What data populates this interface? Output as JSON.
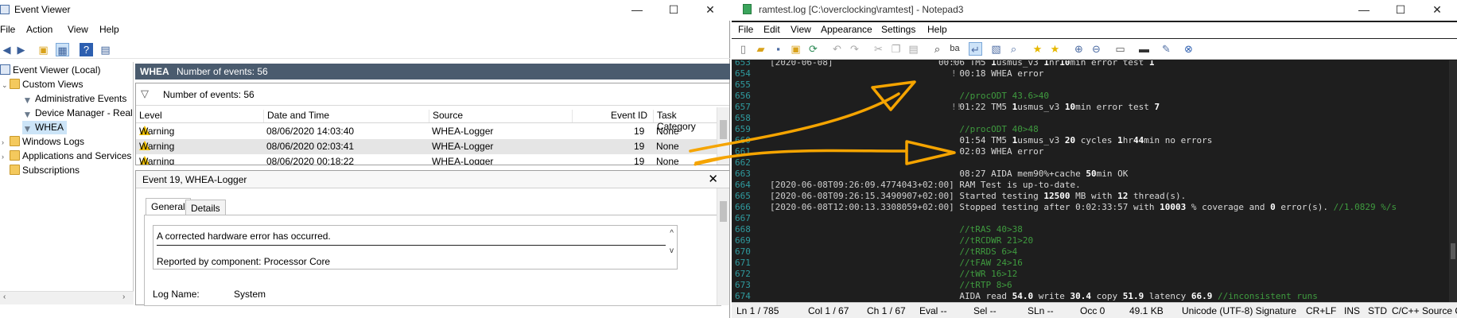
{
  "event_viewer": {
    "title": "Event Viewer",
    "menu": [
      "File",
      "Action",
      "View",
      "Help"
    ],
    "tree": {
      "root": "Event Viewer (Local)",
      "custom_views": "Custom Views",
      "admin_events": "Administrative Events",
      "device_manager": "Device Manager - Real",
      "whea": "WHEA",
      "windows_logs": "Windows Logs",
      "apps_services": "Applications and Services",
      "subscriptions": "Subscriptions"
    },
    "header": {
      "title": "WHEA",
      "count": "Number of events: 56"
    },
    "filter_text": "Number of events: 56",
    "columns": [
      "Level",
      "Date and Time",
      "Source",
      "Event ID",
      "Task Category"
    ],
    "rows": [
      {
        "level": "Warning",
        "datetime": "08/06/2020 14:03:40",
        "source": "WHEA-Logger",
        "event_id": "19",
        "task": "None"
      },
      {
        "level": "Warning",
        "datetime": "08/06/2020 02:03:41",
        "source": "WHEA-Logger",
        "event_id": "19",
        "task": "None"
      },
      {
        "level": "Warning",
        "datetime": "08/06/2020 00:18:22",
        "source": "WHEA-Logger",
        "event_id": "19",
        "task": "None"
      }
    ],
    "detail": {
      "title": "Event 19, WHEA-Logger",
      "tabs": [
        "General",
        "Details"
      ],
      "line1": "A corrected hardware error has occurred.",
      "line2": "Reported by component: Processor Core",
      "log_name_label": "Log Name:",
      "log_name_value": "System"
    }
  },
  "notepad": {
    "title": "ramtest.log [C:\\overclocking\\ramtest] - Notepad3",
    "menu": [
      "File",
      "Edit",
      "View",
      "Appearance",
      "Settings",
      "Help"
    ],
    "lines": [
      {
        "n": "653",
        "mark": "!",
        "parts": [
          [
            "br",
            "[2020-06-08]"
          ],
          [
            "def",
            "                    "
          ],
          [
            "def",
            "00:06 TM5 "
          ],
          [
            "num",
            "1"
          ],
          [
            "def",
            "usmus_v3 "
          ],
          [
            "num",
            "1"
          ],
          [
            "def",
            "hr"
          ],
          [
            "num",
            "10"
          ],
          [
            "def",
            "min error test "
          ],
          [
            "num",
            "1"
          ]
        ]
      },
      {
        "n": "654",
        "mark": "!",
        "parts": [
          [
            "def",
            "                                    00:18 WHEA error"
          ]
        ]
      },
      {
        "n": "655",
        "mark": "",
        "parts": []
      },
      {
        "n": "656",
        "mark": "",
        "parts": [
          [
            "def",
            "                                    "
          ],
          [
            "cm",
            "//procODT 43.6>40"
          ]
        ]
      },
      {
        "n": "657",
        "mark": "!!",
        "parts": [
          [
            "def",
            "                                    01:22 TM5 "
          ],
          [
            "num",
            "1"
          ],
          [
            "def",
            "usmus_v3 "
          ],
          [
            "num",
            "10"
          ],
          [
            "def",
            "min error test "
          ],
          [
            "num",
            "7"
          ]
        ]
      },
      {
        "n": "658",
        "mark": "",
        "parts": []
      },
      {
        "n": "659",
        "mark": "",
        "parts": [
          [
            "def",
            "                                    "
          ],
          [
            "cm",
            "//procODT 40>48"
          ]
        ]
      },
      {
        "n": "660",
        "mark": "",
        "parts": [
          [
            "def",
            "                                    01:54 TM5 "
          ],
          [
            "num",
            "1"
          ],
          [
            "def",
            "usmus_v3 "
          ],
          [
            "num",
            "20"
          ],
          [
            "def",
            " cycles "
          ],
          [
            "num",
            "1"
          ],
          [
            "def",
            "hr"
          ],
          [
            "num",
            "44"
          ],
          [
            "def",
            "min no errors"
          ]
        ]
      },
      {
        "n": "661",
        "mark": "",
        "parts": [
          [
            "def",
            "                                    02:03 WHEA error"
          ]
        ]
      },
      {
        "n": "662",
        "mark": "",
        "parts": []
      },
      {
        "n": "663",
        "mark": "",
        "parts": [
          [
            "def",
            "                                    08:27 AIDA mem90%+cache "
          ],
          [
            "num",
            "50"
          ],
          [
            "def",
            "min OK"
          ]
        ]
      },
      {
        "n": "664",
        "mark": "",
        "parts": [
          [
            "br",
            "[2020-06-08T09:26:09.4774043+02:00]"
          ],
          [
            "def",
            " RAM Test is up-to-date."
          ]
        ]
      },
      {
        "n": "665",
        "mark": "",
        "parts": [
          [
            "br",
            "[2020-06-08T09:26:15.3490907+02:00]"
          ],
          [
            "def",
            " Started testing "
          ],
          [
            "num",
            "12500"
          ],
          [
            "def",
            " MB with "
          ],
          [
            "num",
            "12"
          ],
          [
            "def",
            " thread(s)."
          ]
        ]
      },
      {
        "n": "666",
        "mark": "",
        "parts": [
          [
            "br",
            "[2020-06-08T12:00:13.3308059+02:00]"
          ],
          [
            "def",
            " Stopped testing after 0:02:33:57 with "
          ],
          [
            "num",
            "10003"
          ],
          [
            "def",
            " % coverage and "
          ],
          [
            "num",
            "0"
          ],
          [
            "def",
            " error(s). "
          ],
          [
            "cm",
            "//1.0829 %/s"
          ]
        ]
      },
      {
        "n": "667",
        "mark": "",
        "parts": []
      },
      {
        "n": "668",
        "mark": "",
        "parts": [
          [
            "def",
            "                                    "
          ],
          [
            "cm",
            "//tRAS 40>38"
          ]
        ]
      },
      {
        "n": "669",
        "mark": "",
        "parts": [
          [
            "def",
            "                                    "
          ],
          [
            "cm",
            "//tRCDWR 21>20"
          ]
        ]
      },
      {
        "n": "670",
        "mark": "",
        "parts": [
          [
            "def",
            "                                    "
          ],
          [
            "cm",
            "//tRRDS 6>4"
          ]
        ]
      },
      {
        "n": "671",
        "mark": "",
        "parts": [
          [
            "def",
            "                                    "
          ],
          [
            "cm",
            "//tFAW 24>16"
          ]
        ]
      },
      {
        "n": "672",
        "mark": "",
        "parts": [
          [
            "def",
            "                                    "
          ],
          [
            "cm",
            "//tWR 16>12"
          ]
        ]
      },
      {
        "n": "673",
        "mark": "",
        "parts": [
          [
            "def",
            "                                    "
          ],
          [
            "cm",
            "//tRTP 8>6"
          ]
        ]
      },
      {
        "n": "674",
        "mark": "",
        "parts": [
          [
            "def",
            "                                    AIDA read "
          ],
          [
            "num",
            "54.0"
          ],
          [
            "def",
            " write "
          ],
          [
            "num",
            "30.4"
          ],
          [
            "def",
            " copy "
          ],
          [
            "num",
            "51.9"
          ],
          [
            "def",
            " latency "
          ],
          [
            "num",
            "66.9"
          ],
          [
            "def",
            " "
          ],
          [
            "cm",
            "//inconsistent runs"
          ]
        ]
      }
    ],
    "status": {
      "ln": "Ln 1 / 785",
      "col": "Col 1 / 67",
      "ch": "Ch 1 / 67",
      "eval": "Eval --",
      "sel": "Sel --",
      "sln": "SLn --",
      "occ": "Occ 0",
      "size": "49.1 KB",
      "encoding": "Unicode (UTF-8) Signature",
      "eol": "CR+LF",
      "ins": "INS",
      "std": "STD",
      "lexer": "C/C++ Source Code"
    }
  },
  "colors": {
    "annotation_arrow": "#f5a400",
    "header_bar": "#4a5b6e",
    "editor_bg": "#1e1e1e"
  }
}
